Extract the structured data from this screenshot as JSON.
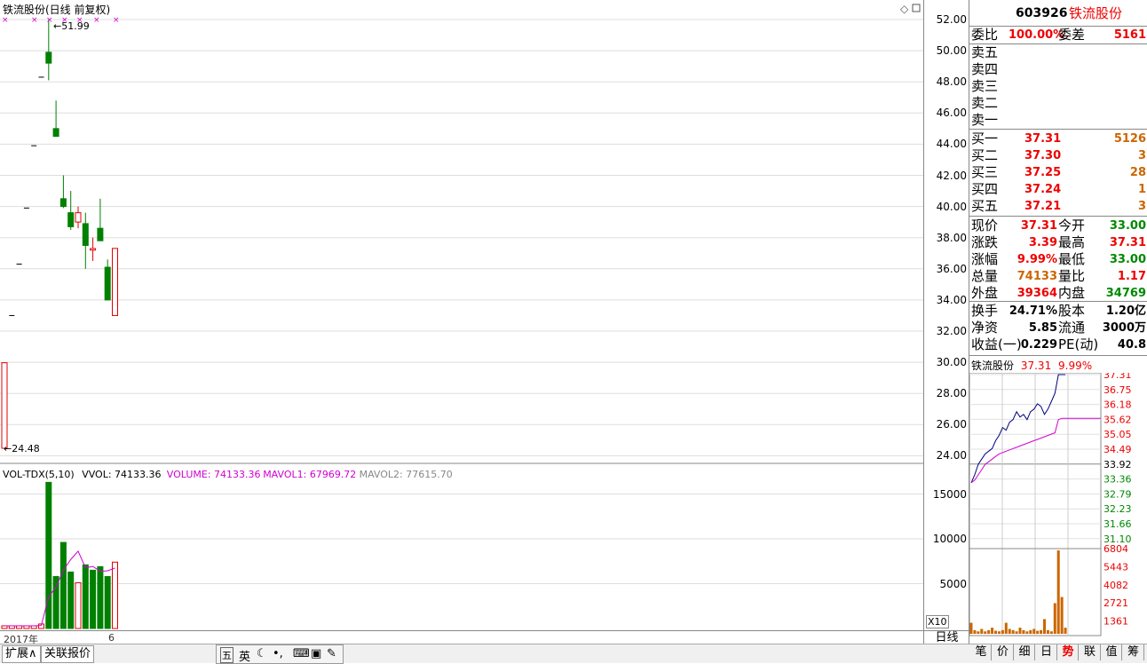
{
  "chart_title": "铁流股份(日线 前复权)",
  "kline": {
    "max_label": "51.99",
    "min_label": "24.48",
    "price_ticks": [
      "52.00",
      "50.00",
      "48.00",
      "46.00",
      "44.00",
      "42.00",
      "40.00",
      "38.00",
      "36.00",
      "34.00",
      "32.00",
      "30.00",
      "28.00",
      "26.00",
      "24.00"
    ],
    "candles": [
      {
        "o": 24.48,
        "h": 29.97,
        "l": 24.48,
        "c": 29.97,
        "up": true
      },
      {
        "o": 33.0,
        "h": 33.0,
        "l": 33.0,
        "c": 33.0,
        "up": true
      },
      {
        "o": 36.3,
        "h": 36.3,
        "l": 36.3,
        "c": 36.3,
        "up": true
      },
      {
        "o": 39.9,
        "h": 39.9,
        "l": 39.9,
        "c": 39.9,
        "up": true
      },
      {
        "o": 43.9,
        "h": 43.9,
        "l": 43.9,
        "c": 43.9,
        "up": true
      },
      {
        "o": 48.3,
        "h": 48.3,
        "l": 48.3,
        "c": 48.3,
        "up": true
      },
      {
        "o": 49.9,
        "h": 51.99,
        "l": 48.1,
        "c": 49.2,
        "up": false
      },
      {
        "o": 45.0,
        "h": 46.8,
        "l": 44.5,
        "c": 44.5,
        "up": false
      },
      {
        "o": 40.5,
        "h": 42.0,
        "l": 39.9,
        "c": 40.0,
        "up": false
      },
      {
        "o": 39.6,
        "h": 41.0,
        "l": 38.5,
        "c": 38.7,
        "up": false
      },
      {
        "o": 39.0,
        "h": 40.0,
        "l": 38.6,
        "c": 39.6,
        "up": true
      },
      {
        "o": 38.9,
        "h": 39.6,
        "l": 36.0,
        "c": 37.5,
        "up": false
      },
      {
        "o": 37.2,
        "h": 38.0,
        "l": 36.5,
        "c": 37.3,
        "up": true
      },
      {
        "o": 38.6,
        "h": 40.5,
        "l": 37.8,
        "c": 37.8,
        "up": false
      },
      {
        "o": 36.1,
        "h": 36.6,
        "l": 34.0,
        "c": 34.0,
        "up": false
      },
      {
        "o": 33.0,
        "h": 37.31,
        "l": 33.0,
        "c": 37.31,
        "up": true
      }
    ]
  },
  "volume": {
    "header_name": "VOL-TDX(5,10)",
    "vvol": "VVOL: 74133.36",
    "volume": "VOLUME: 74133.36",
    "mavol1": "MAVOL1: 67969.72",
    "mavol2": "MAVOL2: 77615.70",
    "ticks": [
      "15000",
      "10000",
      "5000"
    ],
    "bars": [
      {
        "v": 300,
        "up": true
      },
      {
        "v": 300,
        "up": true
      },
      {
        "v": 300,
        "up": true
      },
      {
        "v": 300,
        "up": true
      },
      {
        "v": 300,
        "up": true
      },
      {
        "v": 500,
        "up": true
      },
      {
        "v": 16300,
        "up": false
      },
      {
        "v": 5800,
        "up": false
      },
      {
        "v": 9600,
        "up": false
      },
      {
        "v": 6300,
        "up": false
      },
      {
        "v": 5100,
        "up": true
      },
      {
        "v": 7100,
        "up": false
      },
      {
        "v": 6500,
        "up": false
      },
      {
        "v": 6900,
        "up": false
      },
      {
        "v": 5800,
        "up": false
      },
      {
        "v": 7400,
        "up": true
      }
    ],
    "ma": [
      300,
      300,
      300,
      300,
      300,
      340,
      3540,
      4620,
      6500,
      7700,
      8620,
      6780,
      6920,
      6380,
      6440,
      6740
    ],
    "multiplier": "X10"
  },
  "footer": {
    "year": "2017年",
    "month": "6",
    "period": "日线"
  },
  "quote": {
    "code": "603926",
    "name": "铁流股份",
    "weibi_label": "委比",
    "weibi": "100.00%",
    "weicha_label": "委差",
    "weicha": "5161",
    "asks": [
      {
        "label": "卖五"
      },
      {
        "label": "卖四"
      },
      {
        "label": "卖三"
      },
      {
        "label": "卖二"
      },
      {
        "label": "卖一"
      }
    ],
    "bids": [
      {
        "label": "买一",
        "price": "37.31",
        "vol": "5126"
      },
      {
        "label": "买二",
        "price": "37.30",
        "vol": "3"
      },
      {
        "label": "买三",
        "price": "37.25",
        "vol": "28"
      },
      {
        "label": "买四",
        "price": "37.24",
        "vol": "1"
      },
      {
        "label": "买五",
        "price": "37.21",
        "vol": "3"
      }
    ],
    "stats": [
      {
        "l1": "现价",
        "v1": "37.31",
        "c1": "red",
        "l2": "今开",
        "v2": "33.00",
        "c2": "green"
      },
      {
        "l1": "涨跌",
        "v1": "3.39",
        "c1": "red",
        "l2": "最高",
        "v2": "37.31",
        "c2": "red"
      },
      {
        "l1": "涨幅",
        "v1": "9.99%",
        "c1": "red",
        "l2": "最低",
        "v2": "33.00",
        "c2": "green"
      },
      {
        "l1": "总量",
        "v1": "74133",
        "c1": "orange",
        "l2": "量比",
        "v2": "1.17",
        "c2": "red"
      },
      {
        "l1": "外盘",
        "v1": "39364",
        "c1": "red",
        "l2": "内盘",
        "v2": "34769",
        "c2": "green"
      }
    ],
    "fin": [
      {
        "l1": "换手",
        "v1": "24.71%",
        "l2": "股本",
        "v2": "1.20亿"
      },
      {
        "l1": "净资",
        "v1": "5.85",
        "l2": "流通",
        "v2": "3000万"
      },
      {
        "l1": "收益(一)",
        "v1": "0.229",
        "l2": "PE(动)",
        "v2": "40.8"
      }
    ]
  },
  "mini": {
    "name": "铁流股份",
    "price": "37.31",
    "pct": "9.99%",
    "price_ticks": [
      {
        "v": "37.31",
        "c": "red"
      },
      {
        "v": "36.75",
        "c": "red"
      },
      {
        "v": "36.18",
        "c": "red"
      },
      {
        "v": "35.62",
        "c": "red"
      },
      {
        "v": "35.05",
        "c": "red"
      },
      {
        "v": "34.49",
        "c": "red"
      },
      {
        "v": "33.92",
        "c": "black"
      },
      {
        "v": "33.36",
        "c": "green"
      },
      {
        "v": "32.79",
        "c": "green"
      },
      {
        "v": "32.23",
        "c": "green"
      },
      {
        "v": "31.66",
        "c": "green"
      },
      {
        "v": "31.10",
        "c": "green"
      }
    ],
    "vol_ticks": [
      "6804",
      "5443",
      "4082",
      "2721",
      "1361"
    ]
  },
  "tabs": {
    "expand": "扩展∧",
    "related": "关联报价"
  },
  "ime": {
    "label1": "五",
    "label2": "英"
  },
  "right_tabs": [
    "笔",
    "价",
    "细",
    "日",
    "势",
    "联",
    "值",
    "筹"
  ],
  "colors": {
    "up": "#e00000",
    "down": "#008000",
    "ma": "#d000d0",
    "bg": "#ffffff",
    "grid": "#dddddd"
  }
}
